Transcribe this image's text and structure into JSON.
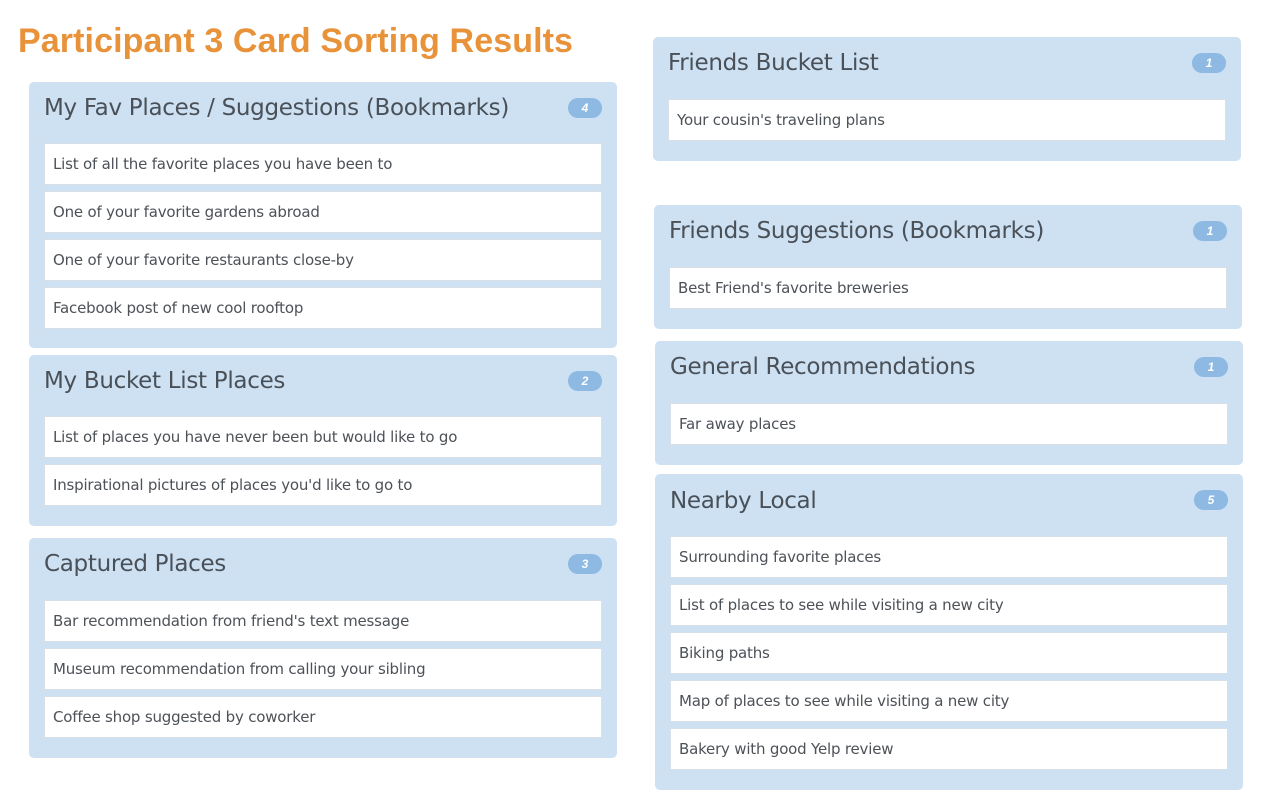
{
  "page": {
    "title": "Participant 3 Card Sorting Results"
  },
  "colors": {
    "title": "#e8923a",
    "panel_bg": "#cde1f2",
    "badge_bg": "#8db9e2",
    "card_bg": "#ffffff"
  },
  "groups": [
    {
      "title": "My Fav Places / Suggestions (Bookmarks)",
      "count": "4",
      "cards": [
        "List of all the favorite places you have been to",
        "One of your favorite gardens abroad",
        "One of your favorite restaurants close-by",
        "Facebook post of new cool rooftop"
      ]
    },
    {
      "title": "My Bucket List Places",
      "count": "2",
      "cards": [
        "List of places you have never been but would like to go",
        "Inspirational pictures of places you'd like to go to"
      ]
    },
    {
      "title": "Captured Places",
      "count": "3",
      "cards": [
        "Bar recommendation from friend's text message",
        "Museum recommendation from calling your sibling",
        "Coffee shop suggested by coworker"
      ]
    },
    {
      "title": "Friends Bucket List",
      "count": "1",
      "cards": [
        "Your cousin's traveling plans"
      ]
    },
    {
      "title": "Friends Suggestions (Bookmarks)",
      "count": "1",
      "cards": [
        "Best Friend's favorite breweries"
      ]
    },
    {
      "title": "General Recommendations",
      "count": "1",
      "cards": [
        "Far away places"
      ]
    },
    {
      "title": "Nearby Local",
      "count": "5",
      "cards": [
        "Surrounding favorite places",
        "List of places to see while visiting a new city",
        "Biking paths",
        "Map of places to see while visiting a new city",
        "Bakery with good Yelp review"
      ]
    }
  ]
}
